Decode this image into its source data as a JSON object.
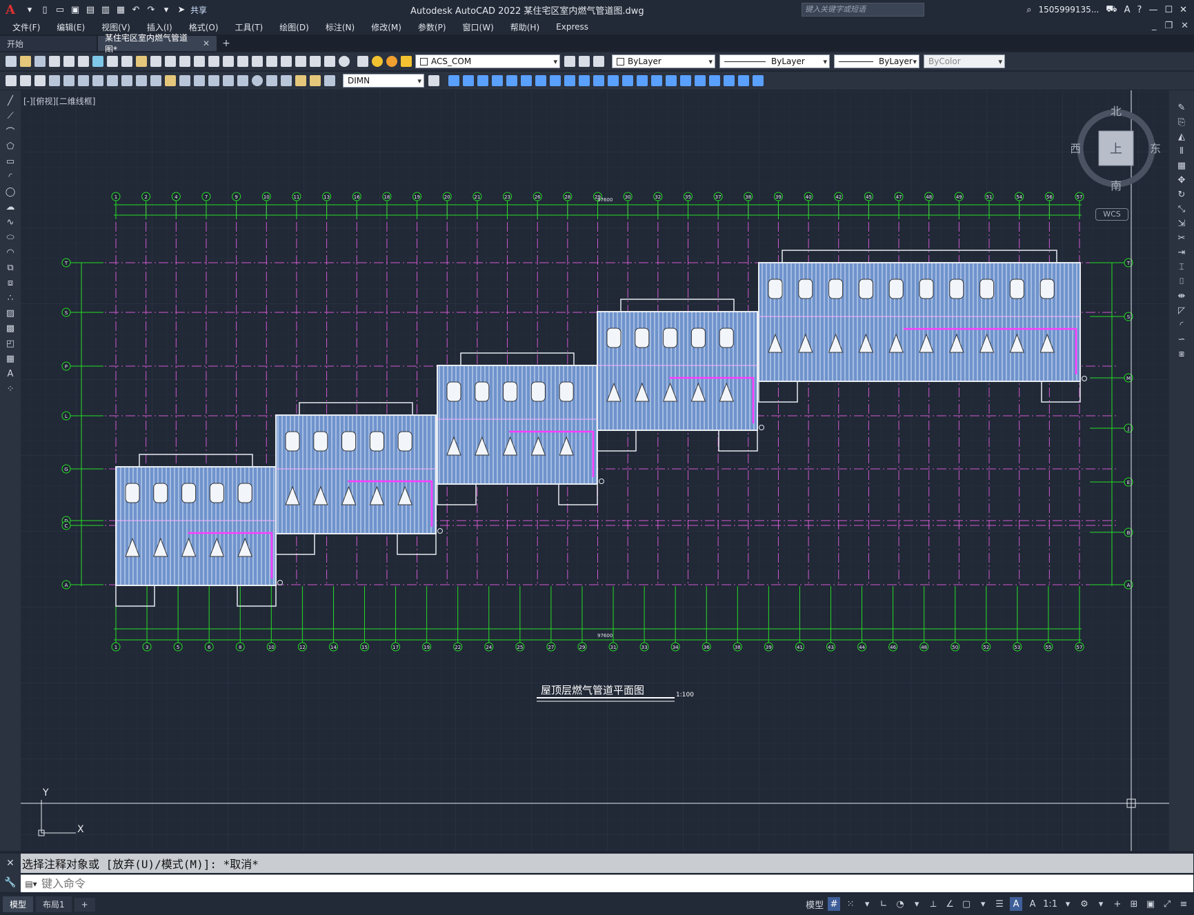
{
  "app": {
    "title": "Autodesk AutoCAD 2022    某住宅区室内燃气管道图.dwg",
    "share_label": "共享",
    "search_placeholder": "键入关键字或短语",
    "user": "1505999135..."
  },
  "menu": [
    "文件(F)",
    "编辑(E)",
    "视图(V)",
    "插入(I)",
    "格式(O)",
    "工具(T)",
    "绘图(D)",
    "标注(N)",
    "修改(M)",
    "参数(P)",
    "窗口(W)",
    "帮助(H)",
    "Express"
  ],
  "tabs": {
    "start": "开始",
    "drawing": "某住宅区室内燃气管道图*"
  },
  "toolbar": {
    "layer": "ACS_COM",
    "color": "ByLayer",
    "linetype": "ByLayer",
    "lineweight": "ByLayer",
    "plotstyle": "ByColor",
    "dimstyle": "DIMN"
  },
  "viewport": {
    "label": "[-][俯视][二维线框]",
    "drawing_title": "屋顶层燃气管道平面图",
    "scale": "1:100",
    "total_dim": "97600"
  },
  "compass": {
    "north": "北",
    "south": "南",
    "east": "东",
    "west": "西",
    "center": "上",
    "wcs": "WCS"
  },
  "ucs": {
    "x": "X",
    "y": "Y"
  },
  "grid": {
    "top_axes": [
      "1",
      "2",
      "4",
      "7",
      "9",
      "10",
      "11",
      "13",
      "16",
      "18",
      "19",
      "20",
      "21",
      "23",
      "26",
      "28",
      "29",
      "30",
      "32",
      "35",
      "37",
      "38",
      "39",
      "40",
      "42",
      "45",
      "47",
      "48",
      "49",
      "51",
      "54",
      "56",
      "57"
    ],
    "bottom_axes": [
      "1",
      "3",
      "5",
      "6",
      "8",
      "10",
      "12",
      "14",
      "15",
      "17",
      "19",
      "22",
      "24",
      "25",
      "27",
      "29",
      "31",
      "33",
      "34",
      "36",
      "38",
      "39",
      "41",
      "43",
      "44",
      "46",
      "48",
      "50",
      "52",
      "53",
      "55",
      "57"
    ],
    "left_axes": [
      "T",
      "S",
      "P",
      "L",
      "G",
      "D",
      "C",
      "A"
    ],
    "right_axes": [
      "A",
      "B",
      "E",
      "J",
      "M",
      "S",
      "T"
    ]
  },
  "command": {
    "history": "选择注释对象或 [放弃(U)/模式(M)]: *取消*",
    "placeholder": "键入命令"
  },
  "status": {
    "tab_model": "模型",
    "tab_layout": "布局1",
    "model_label": "模型",
    "scale": "1:1"
  },
  "colors": {
    "grid": "#2e3646",
    "axis_green": "#25e025",
    "axis_magenta": "#d25ad2",
    "wall": "#e8ecf2",
    "roof_fill": "#7a9fd6",
    "pipe": "#ff3cff"
  }
}
